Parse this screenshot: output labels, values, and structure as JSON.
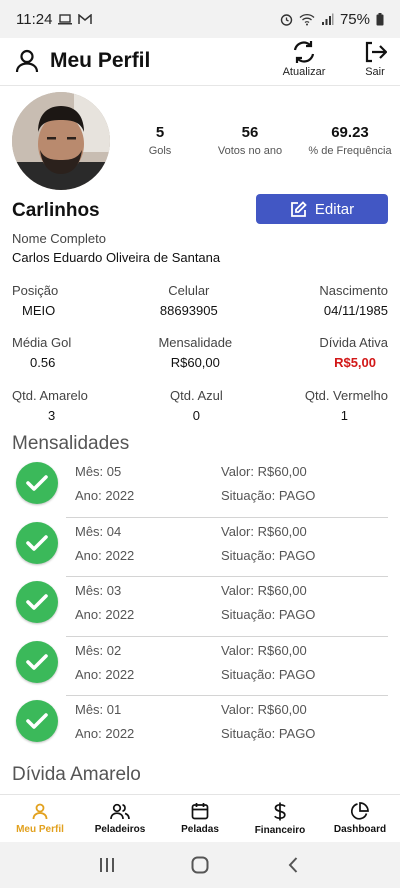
{
  "status_bar": {
    "time": "11:24",
    "battery": "75%"
  },
  "header": {
    "title": "Meu Perfil",
    "refresh_label": "Atualizar",
    "logout_label": "Sair"
  },
  "stats": [
    {
      "value": "5",
      "label": "Gols"
    },
    {
      "value": "56",
      "label": "Votos no ano"
    },
    {
      "value": "69.23",
      "label": "% de Frequência"
    }
  ],
  "profile": {
    "nickname": "Carlinhos",
    "edit_label": "Editar",
    "full_name_label": "Nome Completo",
    "full_name": "Carlos Eduardo Oliveira de Santana"
  },
  "info": {
    "position_label": "Posição",
    "position": "MEIO",
    "phone_label": "Celular",
    "phone": "88693905",
    "birth_label": "Nascimento",
    "birth": "04/11/1985",
    "avg_goal_label": "Média Gol",
    "avg_goal": "0.56",
    "monthly_label": "Mensalidade",
    "monthly": "R$60,00",
    "debt_label": "Dívida Ativa",
    "debt": "R$5,00",
    "yellow_label": "Qtd. Amarelo",
    "yellow": "3",
    "blue_label": "Qtd. Azul",
    "blue": "0",
    "red_label": "Qtd. Vermelho",
    "red": "1"
  },
  "payments_title": "Mensalidades",
  "payments": [
    {
      "month": "Mês: 05",
      "year": "Ano: 2022",
      "value": "Valor: R$60,00",
      "status": "Situação: PAGO"
    },
    {
      "month": "Mês: 04",
      "year": "Ano: 2022",
      "value": "Valor: R$60,00",
      "status": "Situação: PAGO"
    },
    {
      "month": "Mês: 03",
      "year": "Ano: 2022",
      "value": "Valor: R$60,00",
      "status": "Situação: PAGO"
    },
    {
      "month": "Mês: 02",
      "year": "Ano: 2022",
      "value": "Valor: R$60,00",
      "status": "Situação: PAGO"
    },
    {
      "month": "Mês: 01",
      "year": "Ano: 2022",
      "value": "Valor: R$60,00",
      "status": "Situação: PAGO"
    }
  ],
  "yellow_debt_title": "Dívida Amarelo",
  "bottom_nav": [
    {
      "label": "Meu Perfil",
      "icon": "user-icon"
    },
    {
      "label": "Peladeiros",
      "icon": "users-icon"
    },
    {
      "label": "Peladas",
      "icon": "calendar-icon"
    },
    {
      "label": "Financeiro",
      "icon": "dollar-icon"
    },
    {
      "label": "Dashboard",
      "icon": "pie-chart-icon"
    }
  ],
  "colors": {
    "accent": "#4257c4",
    "success": "#3bb95a",
    "debt": "#d21818",
    "active_nav": "#e2a11e"
  }
}
